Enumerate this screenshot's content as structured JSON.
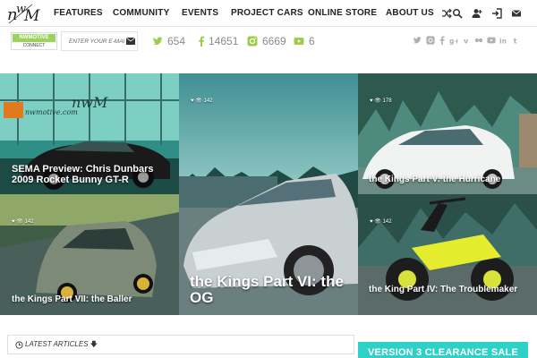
{
  "nav": {
    "items": [
      "FEATURES",
      "COMMUNITY",
      "EVENTS",
      "PROJECT CARS",
      "ONLINE STORE",
      "ABOUT US"
    ]
  },
  "subbar": {
    "badge_top": "NWMOTIVE",
    "badge_bottom": "CONNECT",
    "email_placeholder": "ENTER YOUR E-MAIL",
    "stats": {
      "twitter": "654",
      "facebook": "14651",
      "instagram": "6669",
      "youtube": "6"
    }
  },
  "tiles": [
    {
      "title": "SEMA Preview: Chris Dunbars 2009 Rocket Bunny GT-R",
      "likes": "",
      "views": ""
    },
    {
      "title": "the Kings Part VI: the OG",
      "likes": "",
      "views": "142"
    },
    {
      "title": "the Kings Part V: the Hurricane",
      "likes": "",
      "views": "178"
    },
    {
      "title": "the Kings Part VII: the Baller",
      "likes": "",
      "views": "142"
    },
    {
      "title": "the King Part IV: The Troublemaker",
      "likes": "",
      "views": "142"
    }
  ],
  "latest": {
    "label": "LATEST ARTICLES"
  },
  "clearance": {
    "label": "VERSION 3 CLEARANCE SALE"
  },
  "colors": {
    "accent": "#2ed1c8",
    "badge": "#9bd35c",
    "stat_gray": "#8a8a8a"
  },
  "icons": [
    "random-icon",
    "search-icon",
    "user-add-icon",
    "login-icon",
    "mail-icon",
    "twitter-icon",
    "facebook-icon",
    "instagram-icon",
    "youtube-icon",
    "eye-icon",
    "heart-icon",
    "clock-icon"
  ]
}
